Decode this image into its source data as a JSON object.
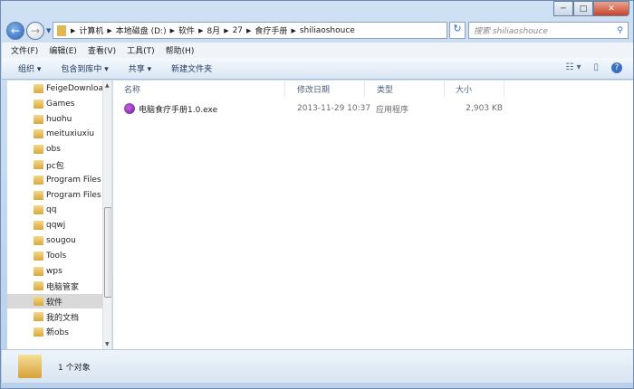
{
  "window": {
    "minimize": "─",
    "maximize": "□",
    "close": "✕"
  },
  "address": {
    "crumbs": [
      "计算机",
      "本地磁盘 (D:)",
      "软件",
      "8月",
      "27",
      "食疗手册",
      "shiliaoshouce"
    ],
    "refresh": "↻"
  },
  "search": {
    "placeholder": "搜索 shiliaoshouce",
    "icon": "search-icon"
  },
  "menu": [
    "文件(F)",
    "编辑(E)",
    "查看(V)",
    "工具(T)",
    "帮助(H)"
  ],
  "toolbar": {
    "organize": "组织 ▾",
    "include": "包含到库中 ▾",
    "share": "共享 ▾",
    "new_folder": "新建文件夹",
    "views": "☷ ▾",
    "preview": "▯",
    "help": "?"
  },
  "nav_items": [
    "FeigeDownloa",
    "Games",
    "huohu",
    "meituxiuxiu",
    "obs",
    "pc包",
    "Program Files",
    "Program Files",
    "qq",
    "qqwj",
    "sougou",
    "Tools",
    "wps",
    "电脑管家",
    "软件",
    "我的文档",
    "新obs"
  ],
  "selected_nav": "软件",
  "columns": {
    "name": "名称",
    "date": "修改日期",
    "type": "类型",
    "size": "大小"
  },
  "files": [
    {
      "name": "电脑食疗手册1.0.exe",
      "date": "2013-11-29 10:37",
      "type": "应用程序",
      "size": "2,903 KB"
    }
  ],
  "status": {
    "count": "1 个对象"
  }
}
